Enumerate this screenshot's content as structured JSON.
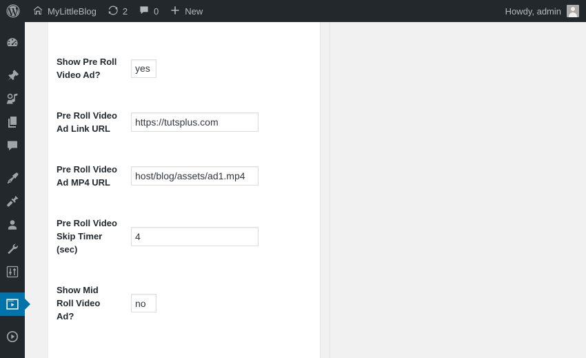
{
  "adminbar": {
    "logo_icon": "wordpress-logo-icon",
    "site_home_icon": "home-icon",
    "site_name": "MyLittleBlog",
    "updates_icon": "updates-icon",
    "updates_count": "2",
    "comments_icon": "comment-bubble-icon",
    "comments_count": "0",
    "new_icon": "plus-icon",
    "new_label": "New",
    "howdy": "Howdy, admin",
    "avatar_icon": "user-avatar-icon",
    "bg_color": "#23282d",
    "text_color": "#b4b9be"
  },
  "adminmenu": {
    "active_color": "#0073aa",
    "items": [
      {
        "name": "dashboard",
        "icon": "dashboard-gauge-icon",
        "current": false
      },
      {
        "name": "posts",
        "icon": "pin-icon",
        "current": false
      },
      {
        "name": "media",
        "icon": "media-icon",
        "current": false
      },
      {
        "name": "pages",
        "icon": "pages-icon",
        "current": false
      },
      {
        "name": "comments",
        "icon": "comment-bubble-icon",
        "current": false
      },
      {
        "name": "appearance",
        "icon": "paintbrush-icon",
        "current": false
      },
      {
        "name": "plugins",
        "icon": "plug-icon",
        "current": false
      },
      {
        "name": "users",
        "icon": "user-icon",
        "current": false
      },
      {
        "name": "tools",
        "icon": "wrench-icon",
        "current": false
      },
      {
        "name": "settings",
        "icon": "sliders-icon",
        "current": false
      },
      {
        "name": "video-ads",
        "icon": "video-play-box-icon",
        "current": true
      },
      {
        "name": "media-player",
        "icon": "play-circle-icon",
        "current": false
      }
    ]
  },
  "settings_form": {
    "fields": [
      {
        "label": "Show Pre Roll Video Ad?",
        "value": "yes",
        "size": "small",
        "name": "show-pre-roll-video-ad"
      },
      {
        "label": "Pre Roll Video Ad Link URL",
        "value": "https://tutsplus.com",
        "size": "regular",
        "name": "pre-roll-video-ad-link-url"
      },
      {
        "label": "Pre Roll Video Ad MP4 URL",
        "value": "host/blog/assets/ad1.mp4",
        "size": "regular",
        "name": "pre-roll-video-ad-mp4-url"
      },
      {
        "label": "Pre Roll Video Skip Timer (sec)",
        "value": "4",
        "size": "regular",
        "name": "pre-roll-video-skip-timer"
      },
      {
        "label": "Show Mid Roll Video Ad?",
        "value": "no",
        "size": "small",
        "name": "show-mid-roll-video-ad"
      }
    ]
  }
}
